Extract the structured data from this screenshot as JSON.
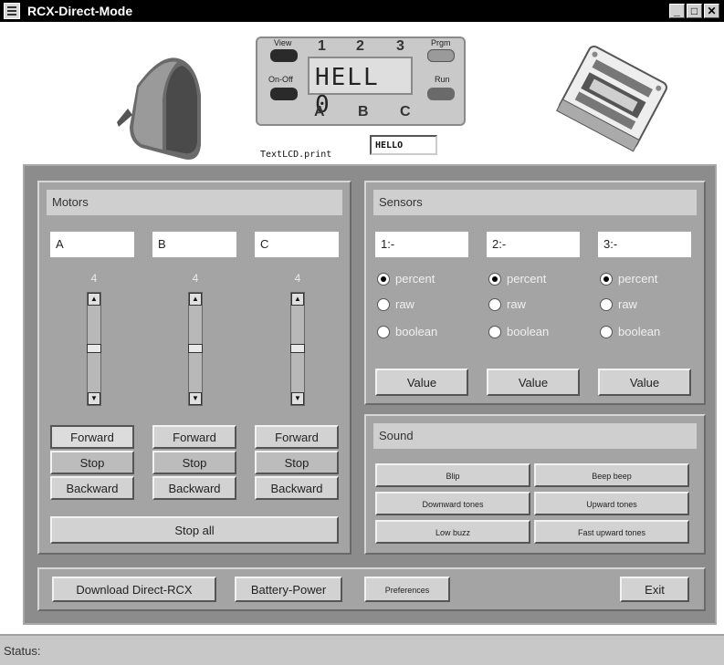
{
  "window": {
    "title": "RCX-Direct-Mode",
    "minimize": "_",
    "maximize": "□",
    "close": "✕"
  },
  "lcd": {
    "display": "HELL 0",
    "numbers": [
      "1",
      "2",
      "3"
    ],
    "ports": [
      "A",
      "B",
      "C"
    ],
    "buttons": {
      "view": "View",
      "onoff": "On-Off",
      "prgm": "Prgm",
      "run": "Run"
    },
    "print_label": "TextLCD.print",
    "print_value": "HELLO"
  },
  "motors": {
    "title": "Motors",
    "items": [
      {
        "name": "A",
        "speed": "4",
        "forward": "Forward",
        "stop": "Stop",
        "backward": "Backward"
      },
      {
        "name": "B",
        "speed": "4",
        "forward": "Forward",
        "stop": "Stop",
        "backward": "Backward"
      },
      {
        "name": "C",
        "speed": "4",
        "forward": "Forward",
        "stop": "Stop",
        "backward": "Backward"
      }
    ],
    "stop_all": "Stop all"
  },
  "sensors": {
    "title": "Sensors",
    "items": [
      {
        "name": "1:-",
        "modes": [
          "percent",
          "raw",
          "boolean"
        ],
        "selected": "percent",
        "value_button": "Value"
      },
      {
        "name": "2:-",
        "modes": [
          "percent",
          "raw",
          "boolean"
        ],
        "selected": "percent",
        "value_button": "Value"
      },
      {
        "name": "3:-",
        "modes": [
          "percent",
          "raw",
          "boolean"
        ],
        "selected": "percent",
        "value_button": "Value"
      }
    ]
  },
  "sound": {
    "title": "Sound",
    "buttons": [
      "Blip",
      "Beep beep",
      "Downward tones",
      "Upward tones",
      "Low buzz",
      "Fast upward tones"
    ]
  },
  "toolbar": {
    "download": "Download Direct-RCX",
    "battery": "Battery-Power",
    "preferences": "Preferences",
    "exit": "Exit"
  },
  "status": {
    "label": "Status:"
  }
}
